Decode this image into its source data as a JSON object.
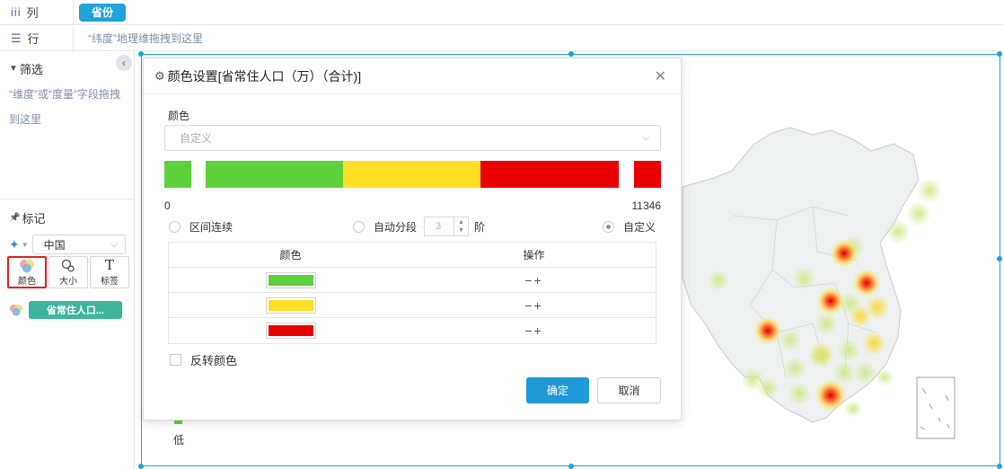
{
  "shelf": {
    "columns": {
      "icon": "column-bars-icon",
      "icon_glyph": "iii",
      "label": "列",
      "pill": "省份"
    },
    "rows": {
      "icon": "list-rows-icon",
      "icon_glyph": "☰",
      "label": "行",
      "hint": "“纬度”地理维拖拽到这里"
    }
  },
  "filter": {
    "icon_glyph": "▼",
    "title": "筛选",
    "hint": "“维度”或“度量”字段拖拽到这里",
    "collapse_glyph": "‹"
  },
  "marks": {
    "icon_glyph": "📌",
    "title": "标记",
    "chart_type_glyph": "✦",
    "chart_type_caret": "▼",
    "map_select": "中国",
    "buttons": [
      {
        "label": "颜色",
        "glyph": "●",
        "icon": "color-palette-icon",
        "active": true
      },
      {
        "label": "大小",
        "glyph": "⚬",
        "icon": "size-circles-icon",
        "active": false
      },
      {
        "label": "标签",
        "glyph": "T",
        "icon": "text-label-icon",
        "active": false
      }
    ],
    "color_field": "省常住人口..."
  },
  "legend": {
    "low_label": "低",
    "low_color": "#5cd13b"
  },
  "dialog": {
    "title_icon": "⚙",
    "title": "颜色设置[省常住人口（万）（合计)]",
    "close_glyph": "✕",
    "color_label": "颜色",
    "color_select_value": "自定义",
    "chevron_glyph": "⌵",
    "range_min": "0",
    "range_max": "11346",
    "colors": {
      "green": "#5cd13b",
      "yellow": "#fde025",
      "red": "#e90000"
    },
    "mode_continuous": "区间连续",
    "mode_auto": "自动分段",
    "auto_steps_value": "3",
    "auto_steps_unit": "阶",
    "mode_custom": "自定义",
    "table": {
      "headers": [
        "颜色",
        "操作"
      ],
      "rows": [
        {
          "color": "#5cd13b",
          "ops": "−+"
        },
        {
          "color": "#fde025",
          "ops": "−+"
        },
        {
          "color": "#e90000",
          "ops": "−+"
        }
      ]
    },
    "reverse_label": "反转颜色",
    "ok_label": "确定",
    "cancel_label": "取消"
  }
}
